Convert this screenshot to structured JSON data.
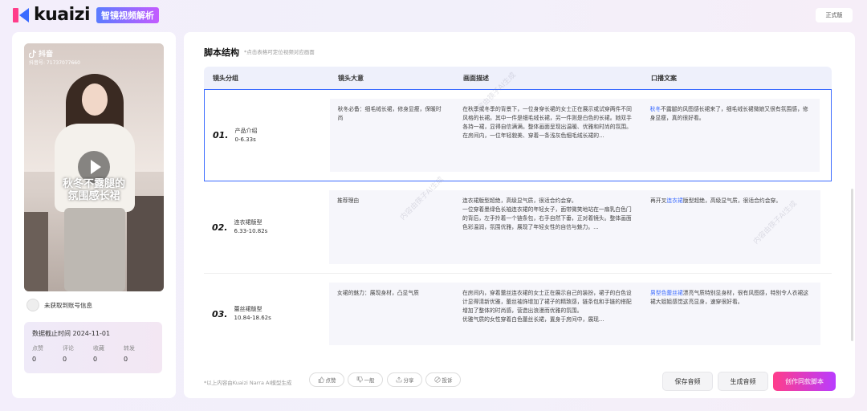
{
  "header": {
    "logo_text": "kuaizi",
    "badge": "智镜视频解析",
    "version_label": "正式版"
  },
  "video": {
    "platform": "抖音",
    "account_id": "抖音号: 71737077660",
    "caption_line1": "秋冬不露腿的",
    "caption_line2": "氛围感长裙"
  },
  "account": {
    "text": "未获取到账号信息"
  },
  "stats": {
    "date_label": "数据截止时间 2024-11-01",
    "items": [
      {
        "label": "点赞",
        "value": "0"
      },
      {
        "label": "评论",
        "value": "0"
      },
      {
        "label": "收藏",
        "value": "0"
      },
      {
        "label": "转发",
        "value": "0"
      }
    ]
  },
  "main": {
    "title": "脚本结构",
    "hint": "*点击表格可定位视频对应画面",
    "columns": [
      "镜头分组",
      "镜头大意",
      "画面描述",
      "口播文案"
    ],
    "watermark": "内容由筷子AI生成",
    "rows": [
      {
        "num": "01.",
        "name": "产品介绍",
        "time": "0-6.33s",
        "idea": "秋冬必备：细毛绒长裙，修身显瘦，保暖时尚",
        "desc": "在秋季或冬季的背景下，一位身穿长裙的女士正在展示或试穿两件不同风格的长裙。其中一件是细毛绒长裙，另一件则是白色的长裙。她双手各持一裙，显得自信满满。整体画面呈现出温暖、优雅和时尚的氛围。\n在房间内，一位年轻貌美、穿着一条浅灰色细毛绒长裙的...",
        "script_hl": "秋冬",
        "script": "不露腿的风图感长裙来了，细毛绒长裙微娘又很有氛围感，修身显瘦，真的很好看。"
      },
      {
        "num": "02.",
        "name": "连衣裙版型",
        "time": "6.33-10.82s",
        "idea": "推荐理由",
        "desc": "连衣裙版型超绝，高级显气质，很适合约会穿。\n一位穿着墨绿色长袖连衣裙的年轻女子，面带微笑地站在一扇乳白色门的背后，左手拎着一个链条包，右手自然下垂，正对着镜头。整体画面色彩温润，氛围优雅，展现了年轻女性的自信与魅力。...",
        "script_pre": "再开叉",
        "script_hl": "连衣裙",
        "script": "版型超绝，高级显气质，很适合约会穿。"
      },
      {
        "num": "03.",
        "name": "蕾丝裙版型",
        "time": "10.84-18.62s",
        "idea": "女裙的魅力：展现身材，凸显气质",
        "desc": "在房间内，穿着蕾丝连衣裙的女士正在展示自己的装扮，裙子的白色设计显得清新优雅，蕾丝袖饰增加了裙子的精致感，链条包和手链的搭配增加了整体的时尚感，营造出浪漫而优雅的氛围。\n优雅气质的女性穿着白色蕾丝长裙，置身于房间中，展现...",
        "script_hl": "男型色蕾丝裙",
        "script": "漂亮气质特别显身材，很有风图感，特别令人衣裙这裙大姐姐感觉这亮显身，速穿很好看。"
      }
    ]
  },
  "footer": {
    "note": "*以上内容由Kuaizi Narra AI模型生成",
    "feedback": [
      {
        "icon": "thumb-up-icon",
        "label": "点赞"
      },
      {
        "icon": "thumb-down-icon",
        "label": "一般"
      },
      {
        "icon": "share-icon",
        "label": "分享"
      },
      {
        "icon": "report-icon",
        "label": "投诉"
      }
    ],
    "save_audio": "保存音频",
    "gen_audio": "生成音频",
    "create_script": "创作同款脚本"
  }
}
